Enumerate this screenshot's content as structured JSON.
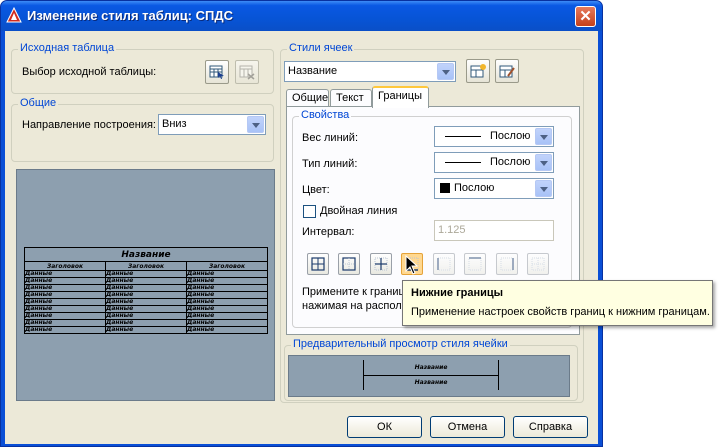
{
  "window": {
    "title": "Изменение стиля таблиц: СПДС"
  },
  "source_table": {
    "group_title": "Исходная таблица",
    "select_label": "Выбор исходной таблицы:"
  },
  "general": {
    "group_title": "Общие",
    "direction_label": "Направление построения:",
    "direction_value": "Вниз"
  },
  "cell_styles": {
    "group_title": "Стили ячеек",
    "selected": "Название"
  },
  "tabs": [
    {
      "label": "Общие"
    },
    {
      "label": "Текст"
    },
    {
      "label": "Границы"
    }
  ],
  "borders": {
    "properties_title": "Свойства",
    "lineweight_label": "Вес линий:",
    "lineweight_value": "Послою",
    "linetype_label": "Тип линий:",
    "linetype_value": "Послою",
    "color_label": "Цвет:",
    "color_value": "Послою",
    "double_line_label": "Двойная линия",
    "interval_label": "Интервал:",
    "interval_value": "1.125",
    "hint_line1": "Примените к границ",
    "hint_line2": "нажимая на располо"
  },
  "tooltip": {
    "title": "Нижние границы",
    "description": "Применение настроек свойств границ к нижним границам."
  },
  "cell_preview": {
    "group_title": "Предварительный просмотр стиля ячейки",
    "row1": "Название",
    "row2": "Название"
  },
  "table_preview": {
    "title": "Название",
    "header": [
      "Заголовок",
      "Заголовок",
      "Заголовок"
    ],
    "cell": "Данные",
    "row_count": 9
  },
  "buttons": {
    "ok": "ОК",
    "cancel": "Отмена",
    "help": "Справка"
  },
  "colors": {
    "title_bar": "#0754d6",
    "dialog_bg": "#ece9d8",
    "group_title": "#0046d5",
    "preview_bg": "#8d9faf",
    "tooltip_bg": "#ffffe1",
    "hover_button": "#ffd890"
  }
}
